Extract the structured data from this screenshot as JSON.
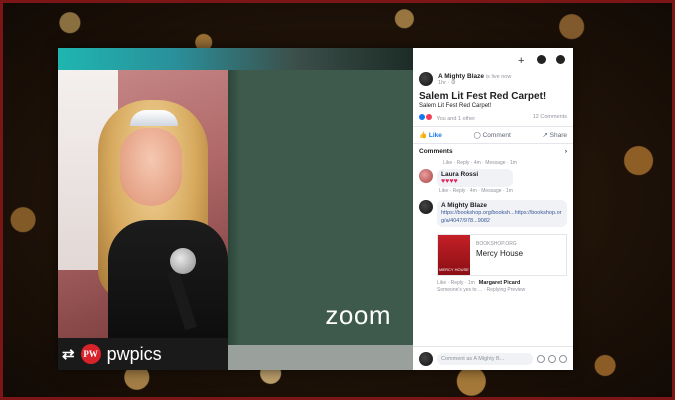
{
  "overlay": {
    "handle": "pwpics",
    "badge": "PW",
    "repost_glyph": "⇄"
  },
  "zoom": {
    "logo": "zoom"
  },
  "facebook": {
    "author": "A Mighty Blaze",
    "author_meta": "is live now",
    "time": "1hr · ⚙",
    "title": "Salem Lit Fest Red Carpet!",
    "subtitle": "Salem Lit Fest Red Carpet!",
    "reactions_text": "You and 1 other",
    "comments_count": "12 Comments",
    "like_label": "Like",
    "comment_label": "Comment",
    "share_label": "Share",
    "comments_header": "Comments",
    "comment_actions": "Like · Reply · 4m · Message · 1m",
    "comments": [
      {
        "name": "Laura Rossi",
        "text": "♥♥♥♥",
        "actions": "Like · Reply · 4m · Message · 1m"
      },
      {
        "name": "A Mighty Blaze",
        "text": "https://bookshop.org/booksh...https://bookshop.org/a/4047/978...9082",
        "actions": ""
      }
    ],
    "book": {
      "source": "BOOKSHOP.ORG",
      "title": "Mercy House",
      "cover_text": "MERCY HOUSE"
    },
    "reply_actions": "Like · Reply · 1m",
    "reply_name": "Margaret Picard",
    "reply_sub": "Someone's yes to ... · Replying Preview",
    "composer_placeholder": "Comment as A Mighty B..."
  }
}
